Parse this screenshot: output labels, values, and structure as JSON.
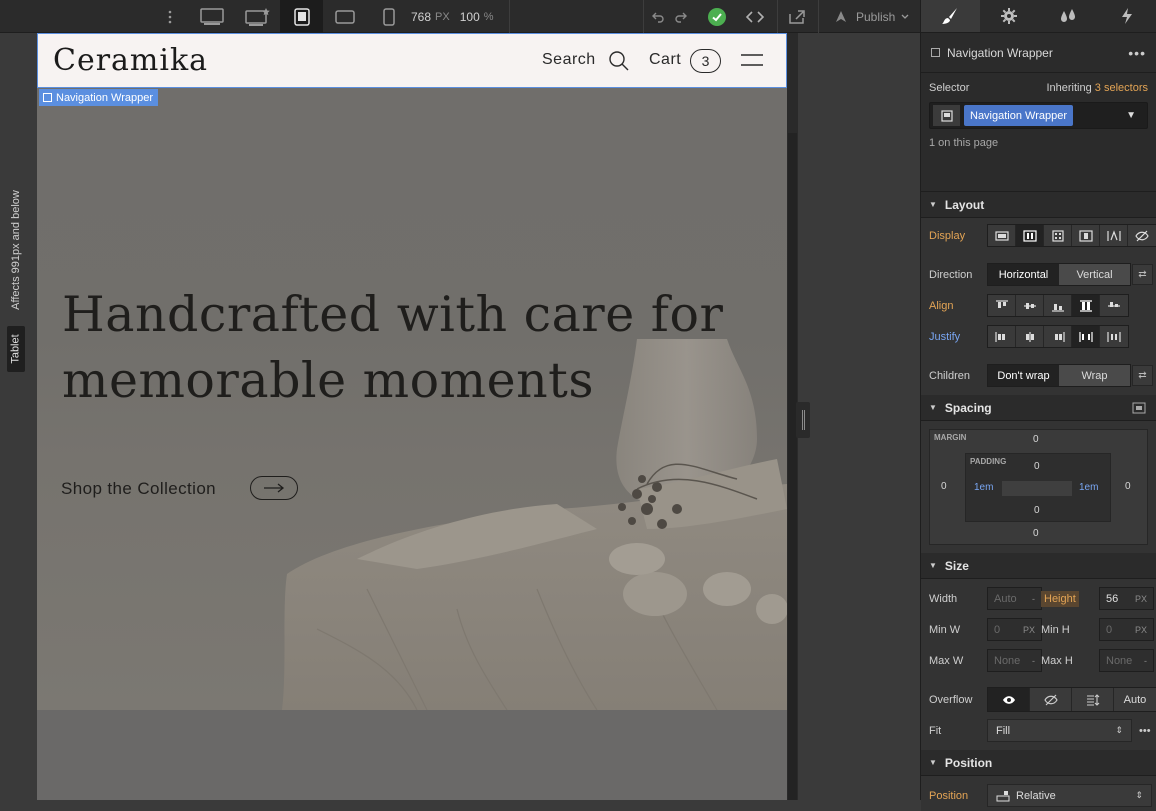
{
  "topbar": {
    "width_readout": "768",
    "width_unit": "PX",
    "zoom_readout": "100",
    "zoom_unit": "%",
    "publish_label": "Publish"
  },
  "breakpoint": {
    "name": "Tablet",
    "affects": "Affects 991px and below"
  },
  "site": {
    "logo": "Ceramika",
    "nav_search": "Search",
    "nav_cart": "Cart",
    "cart_count": "3",
    "selected_tag": "Navigation Wrapper",
    "hero_title": "Handcrafted with care for memorable moments",
    "shop_link": "Shop the Collection"
  },
  "panel": {
    "element_name": "Navigation Wrapper",
    "selector_label": "Selector",
    "inheriting_label": "Inheriting",
    "inheriting_count": "3 selectors",
    "selector_chip": "Navigation Wrapper",
    "on_page": "1 on this page",
    "layout": {
      "title": "Layout",
      "display_label": "Display",
      "direction_label": "Direction",
      "direction_options": [
        "Horizontal",
        "Vertical"
      ],
      "align_label": "Align",
      "justify_label": "Justify",
      "children_label": "Children",
      "children_options": [
        "Don't wrap",
        "Wrap"
      ]
    },
    "spacing": {
      "title": "Spacing",
      "margin_label": "MARGIN",
      "padding_label": "PADDING",
      "margin_top": "0",
      "margin_right": "0",
      "margin_bottom": "0",
      "margin_left": "0",
      "padding_top": "0",
      "padding_right": "1em",
      "padding_bottom": "0",
      "padding_left": "1em"
    },
    "size": {
      "title": "Size",
      "width_label": "Width",
      "width_value": "Auto",
      "height_label": "Height",
      "height_value": "56",
      "px": "PX",
      "minw_label": "Min W",
      "minw_value": "0",
      "minh_label": "Min H",
      "minh_value": "0",
      "maxw_label": "Max W",
      "maxw_value": "None",
      "maxh_label": "Max H",
      "maxh_value": "None",
      "overflow_label": "Overflow",
      "overflow_auto": "Auto",
      "fit_label": "Fit",
      "fit_value": "Fill"
    },
    "position": {
      "title": "Position",
      "position_label": "Position",
      "position_value": "Relative"
    }
  },
  "colors": {
    "accent_blue": "#5b8fe0",
    "selector_chip": "#4a76c9",
    "modified_orange": "#e3a455",
    "status_green": "#4caf50"
  }
}
